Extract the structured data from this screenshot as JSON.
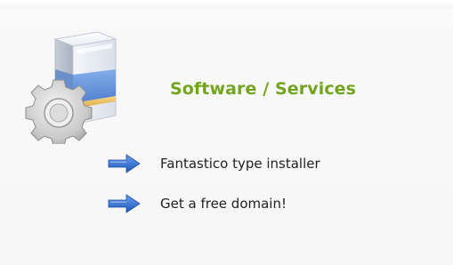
{
  "section": {
    "title": "Software / Services",
    "icon": "software-server-gear-icon",
    "title_color": "#72a51d"
  },
  "links": [
    {
      "label": "Fantastico type installer",
      "icon": "blue-arrow-icon"
    },
    {
      "label": "Get a free domain!",
      "icon": "blue-arrow-icon"
    }
  ],
  "colors": {
    "arrow_blue": "#2f6fd0",
    "text": "#222222"
  }
}
